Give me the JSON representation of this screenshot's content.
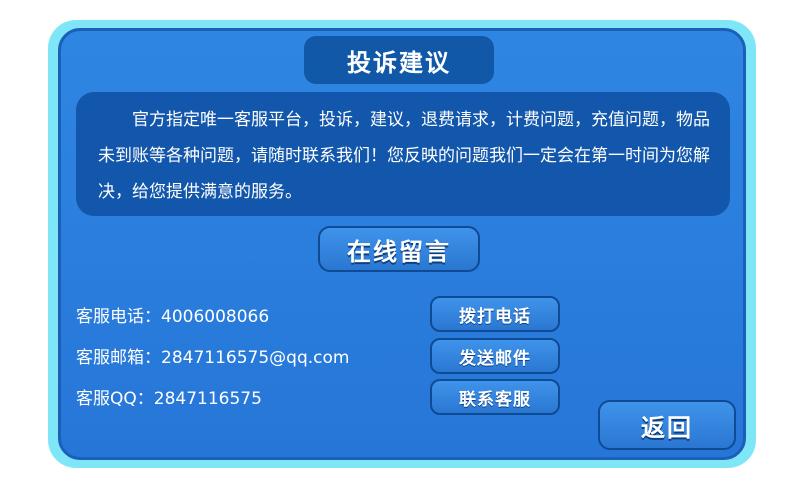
{
  "header": {
    "title": "投诉建议"
  },
  "description": {
    "text": "官方指定唯一客服平台，投诉，建议，退费请求，计费问题，充值问题，物品未到账等各种问题，请随时联系我们！您反映的问题我们一定会在第一时间为您解决，给您提供满意的服务。"
  },
  "online": {
    "button_label": "在线留言"
  },
  "contacts": {
    "phone": "客服电话：4006008066",
    "email": "客服邮箱：2847116575@qq.com",
    "qq": "客服QQ：2847116575"
  },
  "actions": {
    "call_label": "拨打电话",
    "mail_label": "发送邮件",
    "contact_label": "联系客服"
  },
  "footer": {
    "back_label": "返回"
  },
  "colors": {
    "frame": "#7fe6f8",
    "panel": "#2f86e2",
    "dark_box": "#1257ab",
    "button_border": "#0f4b94"
  }
}
